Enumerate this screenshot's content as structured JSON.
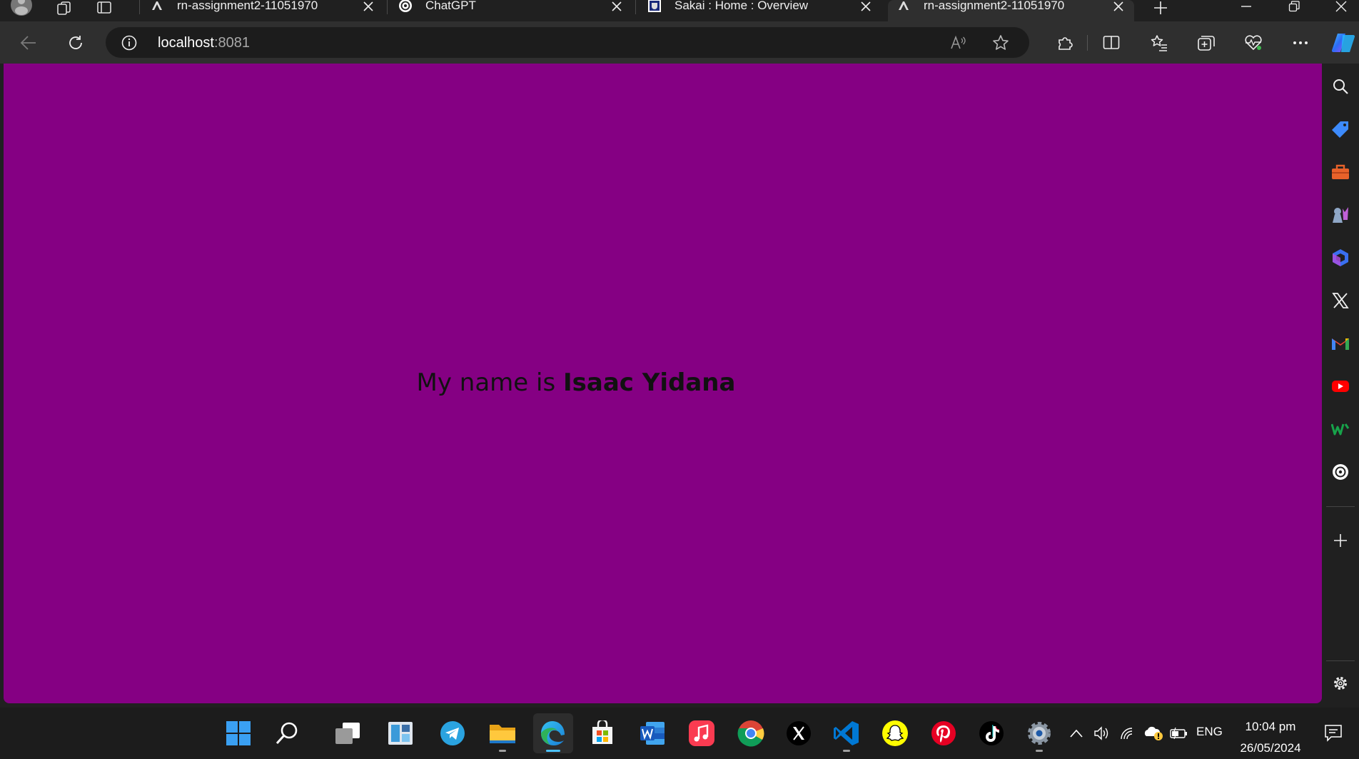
{
  "tabs": [
    {
      "title": "rn-assignment2-11051970",
      "icon": "expo-icon",
      "active": false
    },
    {
      "title": "ChatGPT",
      "icon": "openai-icon",
      "active": false
    },
    {
      "title": "Sakai : Home : Overview",
      "icon": "sakai-icon",
      "active": false
    },
    {
      "title": "rn-assignment2-11051970",
      "icon": "expo-icon",
      "active": true
    }
  ],
  "address_bar": {
    "host": "localhost",
    "port": ":8081"
  },
  "page": {
    "prefix": "My name is ",
    "name": "Isaac Yidana",
    "background": "#850083",
    "text_color": "#111111"
  },
  "sidebar": {
    "items": [
      "search-icon",
      "shopping-tag-icon",
      "toolbox-icon",
      "games-icon",
      "microsoft-365-icon",
      "x-icon",
      "gmail-icon",
      "youtube-icon",
      "wordament-icon",
      "openai-icon"
    ]
  },
  "taskbar": {
    "apps": [
      "windows-start-icon",
      "search-icon",
      "task-view-icon",
      "widgets-icon",
      "telegram-icon",
      "file-explorer-icon",
      "edge-icon",
      "microsoft-store-icon",
      "word-icon",
      "apple-music-icon",
      "chrome-icon",
      "x-icon",
      "vscode-icon",
      "snapchat-icon",
      "pinterest-icon",
      "tiktok-icon",
      "settings-icon"
    ],
    "language": "ENG",
    "time": "10:04 pm",
    "date": "26/05/2024"
  },
  "colors": {
    "accent": "#4cc2ff",
    "browser_chrome": "#2f2f2f",
    "tabstrip": "#202020"
  }
}
